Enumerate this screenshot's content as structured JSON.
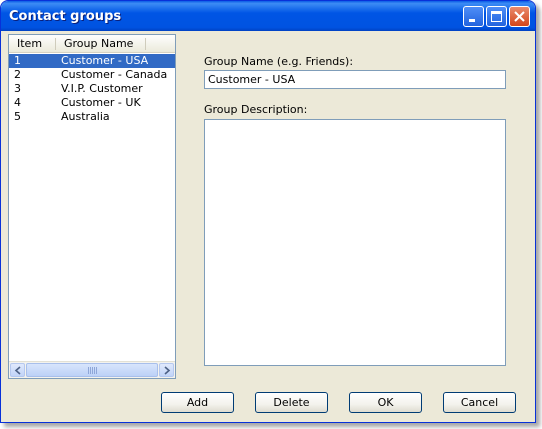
{
  "window": {
    "title": "Contact groups"
  },
  "list": {
    "headers": {
      "item": "Item",
      "name": "Group Name"
    },
    "rows": [
      {
        "item": "1",
        "name": "Customer - USA",
        "selected": true
      },
      {
        "item": "2",
        "name": "Customer - Canada",
        "selected": false
      },
      {
        "item": "3",
        "name": "V.I.P. Customer",
        "selected": false
      },
      {
        "item": "4",
        "name": "Customer - UK",
        "selected": false
      },
      {
        "item": "5",
        "name": "Australia",
        "selected": false
      }
    ]
  },
  "form": {
    "name_label": "Group Name (e.g. Friends):",
    "name_value": "Customer - USA",
    "desc_label": "Group Description:",
    "desc_value": ""
  },
  "buttons": {
    "add": "Add",
    "delete": "Delete",
    "ok": "OK",
    "cancel": "Cancel"
  },
  "colors": {
    "selection": "#316ac5",
    "titlebar": "#0055e5",
    "face": "#ece9d8"
  }
}
